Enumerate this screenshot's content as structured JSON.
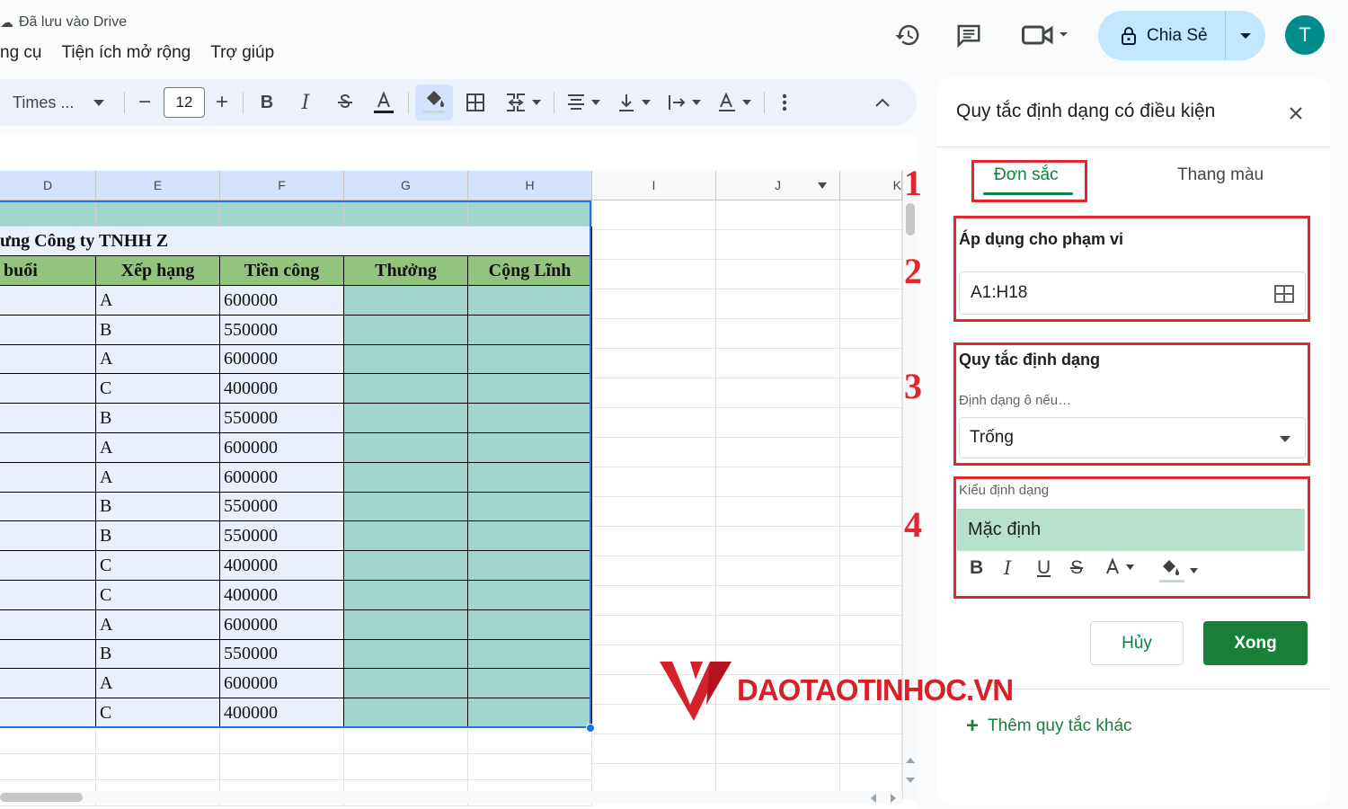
{
  "header": {
    "saved_status": "Đã lưu vào Drive",
    "menu": [
      "ng cụ",
      "Tiện ích mở rộng",
      "Trợ giúp"
    ],
    "share_label": "Chia Sẻ",
    "avatar_letter": "T"
  },
  "toolbar": {
    "font_name": "Times ...",
    "font_size": "12",
    "minus": "−",
    "plus": "+",
    "bold": "B",
    "italic": "I"
  },
  "sheet": {
    "columns": [
      "D",
      "E",
      "F",
      "G",
      "H",
      "I",
      "J",
      "K"
    ],
    "title_fragment": "ưng Công ty TNHH Z",
    "headers": [
      "buổi",
      "Xếp hạng",
      "Tiền công",
      "Thưởng",
      "Cộng Lĩnh"
    ],
    "rows": [
      {
        "rank": "A",
        "wage": "600000"
      },
      {
        "rank": "B",
        "wage": "550000"
      },
      {
        "rank": "A",
        "wage": "600000"
      },
      {
        "rank": "C",
        "wage": "400000"
      },
      {
        "rank": "B",
        "wage": "550000"
      },
      {
        "rank": "A",
        "wage": "600000"
      },
      {
        "rank": "A",
        "wage": "600000"
      },
      {
        "rank": "B",
        "wage": "550000"
      },
      {
        "rank": "B",
        "wage": "550000"
      },
      {
        "rank": "C",
        "wage": "400000"
      },
      {
        "rank": "C",
        "wage": "400000"
      },
      {
        "rank": "A",
        "wage": "600000"
      },
      {
        "rank": "B",
        "wage": "550000"
      },
      {
        "rank": "A",
        "wage": "600000"
      },
      {
        "rank": "C",
        "wage": "400000"
      }
    ]
  },
  "panel": {
    "title": "Quy tắc định dạng có điều kiện",
    "tab_single": "Đơn sắc",
    "tab_scale": "Thang màu",
    "range_label": "Áp dụng cho phạm vi",
    "range_value": "A1:H18",
    "rule_label": "Quy tắc định dạng",
    "condition_label": "Định dạng ô nếu…",
    "condition_value": "Trống",
    "style_label": "Kiểu định dạng",
    "style_preview": "Mặc định",
    "cancel": "Hủy",
    "done": "Xong",
    "add_rule": "Thêm quy tắc khác"
  },
  "annotations": {
    "steps": [
      "1",
      "2",
      "3",
      "4"
    ],
    "watermark": "DAOTAOTINHOC.VN"
  },
  "colors": {
    "accent_green": "#188038",
    "annotation_red": "#e0262f",
    "share_bg": "#c2e7ff",
    "header_green": "#93c47d",
    "cell_teal": "#a2d5cb",
    "cell_blue": "#e8f0fe"
  }
}
